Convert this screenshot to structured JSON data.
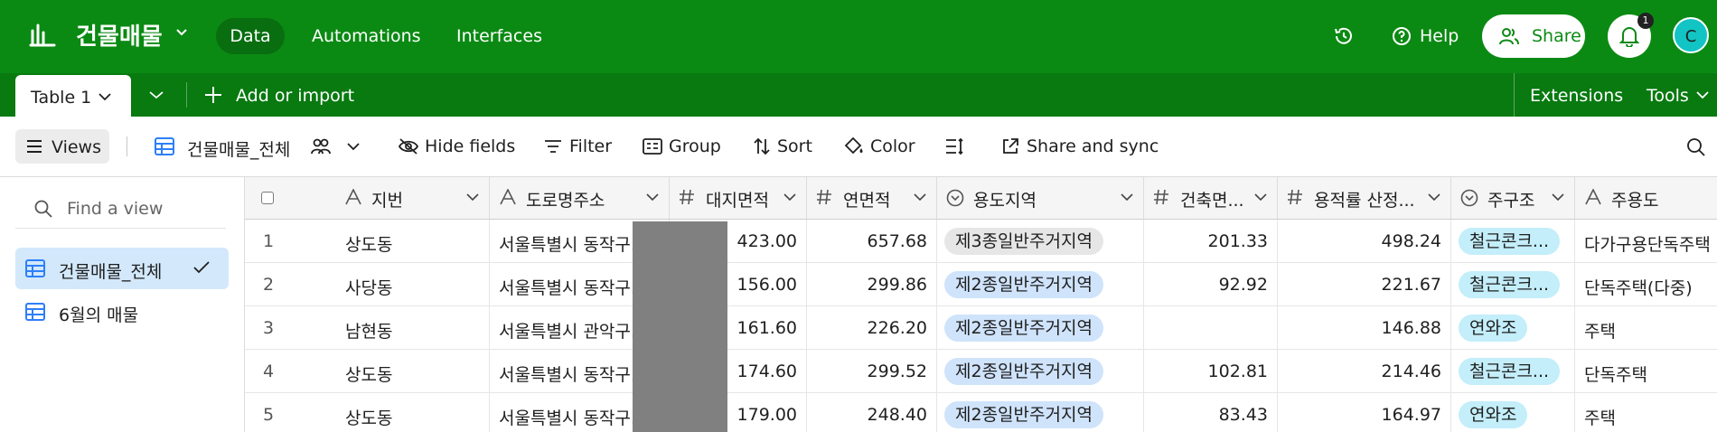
{
  "app": {
    "base_name": "건물매물",
    "nav": [
      "Data",
      "Automations",
      "Interfaces"
    ],
    "help_label": "Help",
    "share_label": "Share",
    "notification_count": "1",
    "avatar_initial": "C",
    "brand_color": "#0b8a13"
  },
  "tabs": {
    "active_table": "Table 1",
    "add_import": "Add or import",
    "extensions": "Extensions",
    "tools": "Tools"
  },
  "toolbar": {
    "views_label": "Views",
    "current_view": "건물매물_전체",
    "hide_fields": "Hide fields",
    "filter": "Filter",
    "group": "Group",
    "sort": "Sort",
    "color": "Color",
    "share_sync": "Share and sync"
  },
  "sidebar": {
    "find_placeholder": "Find a view",
    "views": [
      {
        "label": "건물매물_전체",
        "active": true
      },
      {
        "label": "6월의 매물",
        "active": false
      }
    ]
  },
  "grid": {
    "columns": [
      {
        "label": "지번",
        "type_icon": "text-icon"
      },
      {
        "label": "도로명주소",
        "type_icon": "text-icon"
      },
      {
        "label": "대지면적",
        "type_icon": "number-icon"
      },
      {
        "label": "연면적",
        "type_icon": "number-icon"
      },
      {
        "label": "용도지역",
        "type_icon": "single-select-icon"
      },
      {
        "label": "건축면...",
        "type_icon": "number-icon"
      },
      {
        "label": "용적률 산정...",
        "type_icon": "number-icon"
      },
      {
        "label": "주구조",
        "type_icon": "single-select-icon"
      },
      {
        "label": "주용도",
        "type_icon": "text-icon"
      }
    ],
    "rows": [
      {
        "n": "1",
        "jibun": "상도동",
        "road": "서울특별시 동작구...",
        "land": "423.00",
        "floor": "657.68",
        "zone": "제3종일반주거지역",
        "bldg": "201.33",
        "far": "498.24",
        "struct": "철근콘크...",
        "use": "다가구용단독주택"
      },
      {
        "n": "2",
        "jibun": "사당동",
        "road": "서울특별시 동작구...",
        "land": "156.00",
        "floor": "299.86",
        "zone": "제2종일반주거지역",
        "bldg": "92.92",
        "far": "221.67",
        "struct": "철근콘크...",
        "use": "단독주택(다중)"
      },
      {
        "n": "3",
        "jibun": "남현동",
        "road": "서울특별시 관악구...",
        "land": "161.60",
        "floor": "226.20",
        "zone": "제2종일반주거지역",
        "bldg": "",
        "far": "146.88",
        "struct": "연와조",
        "use": "주택"
      },
      {
        "n": "4",
        "jibun": "상도동",
        "road": "서울특별시 동작구...",
        "land": "174.60",
        "floor": "299.52",
        "zone": "제2종일반주거지역",
        "bldg": "102.81",
        "far": "214.46",
        "struct": "철근콘크...",
        "use": "단독주택"
      },
      {
        "n": "5",
        "jibun": "상도동",
        "road": "서울특별시 동작구...",
        "land": "179.00",
        "floor": "248.40",
        "zone": "제2종일반주거지역",
        "bldg": "83.43",
        "far": "164.97",
        "struct": "연와조",
        "use": "주택"
      }
    ]
  }
}
